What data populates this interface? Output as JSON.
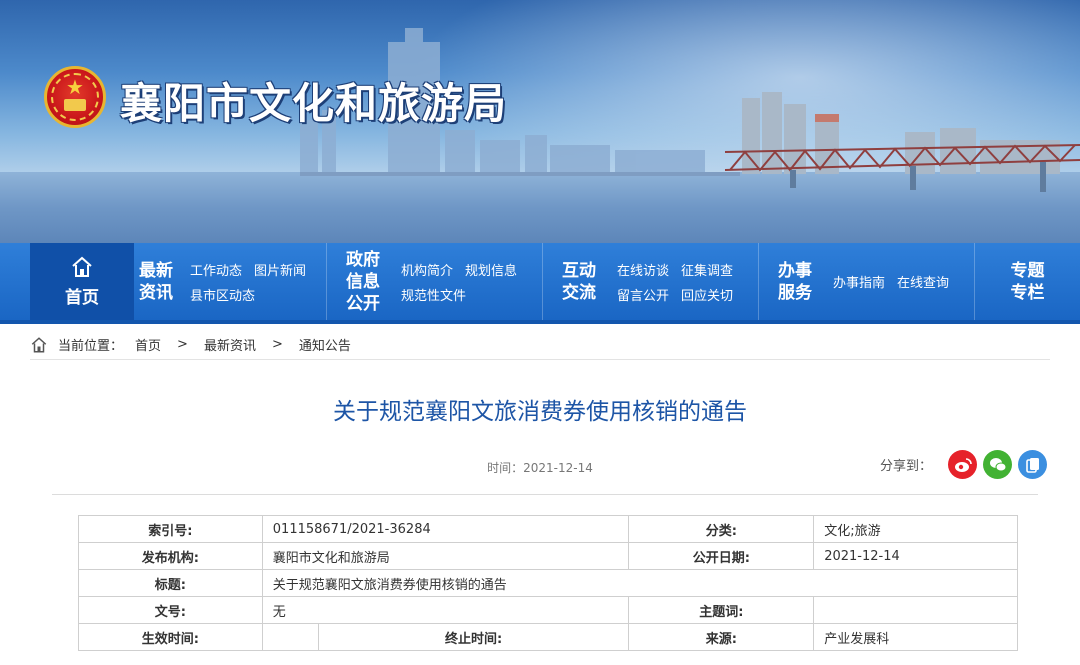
{
  "site": {
    "title": "襄阳市文化和旅游局"
  },
  "nav": {
    "home": "首页",
    "groups": [
      {
        "cat": [
          "最新",
          "资讯"
        ],
        "links": [
          [
            "工作动态",
            "图片新闻"
          ],
          [
            "县市区动态"
          ]
        ]
      },
      {
        "cat": [
          "政府",
          "信息",
          "公开"
        ],
        "links": [
          [
            "机构简介",
            "规划信息"
          ],
          [
            "规范性文件"
          ]
        ]
      },
      {
        "cat": [
          "互动",
          "交流"
        ],
        "links": [
          [
            "在线访谈",
            "征集调查"
          ],
          [
            "留言公开",
            "回应关切"
          ]
        ]
      },
      {
        "cat": [
          "办事",
          "服务"
        ],
        "links": [
          [
            "办事指南",
            "在线查询"
          ]
        ]
      },
      {
        "cat": [
          "专题",
          "专栏"
        ],
        "links": []
      }
    ]
  },
  "breadcrumb": {
    "prefix": "当前位置：",
    "items": [
      "首页",
      "最新资讯",
      "通知公告"
    ],
    "sep": ">"
  },
  "article": {
    "title": "关于规范襄阳文旅消费券使用核销的通告",
    "time_label": "时间：",
    "time": "2021-12-14",
    "share_label": "分享到："
  },
  "info": {
    "index_label": "索引号:",
    "index": "011158671/2021-36284",
    "category_label": "分类:",
    "category": "文化;旅游",
    "publisher_label": "发布机构:",
    "publisher": "襄阳市文化和旅游局",
    "pubdate_label": "公开日期:",
    "pubdate": "2021-12-14",
    "title_label": "标题:",
    "title": "关于规范襄阳文旅消费券使用核销的通告",
    "docno_label": "文号:",
    "docno": "无",
    "topic_label": "主题词:",
    "topic": "",
    "effective_label": "生效时间:",
    "effective": "",
    "expire_label": "终止时间:",
    "expire": "",
    "source_label": "来源:",
    "source": "产业发展科"
  },
  "icons": {
    "share_weibo": "weibo-icon",
    "share_wechat": "wechat-icon",
    "share_copy": "copy-icon"
  }
}
